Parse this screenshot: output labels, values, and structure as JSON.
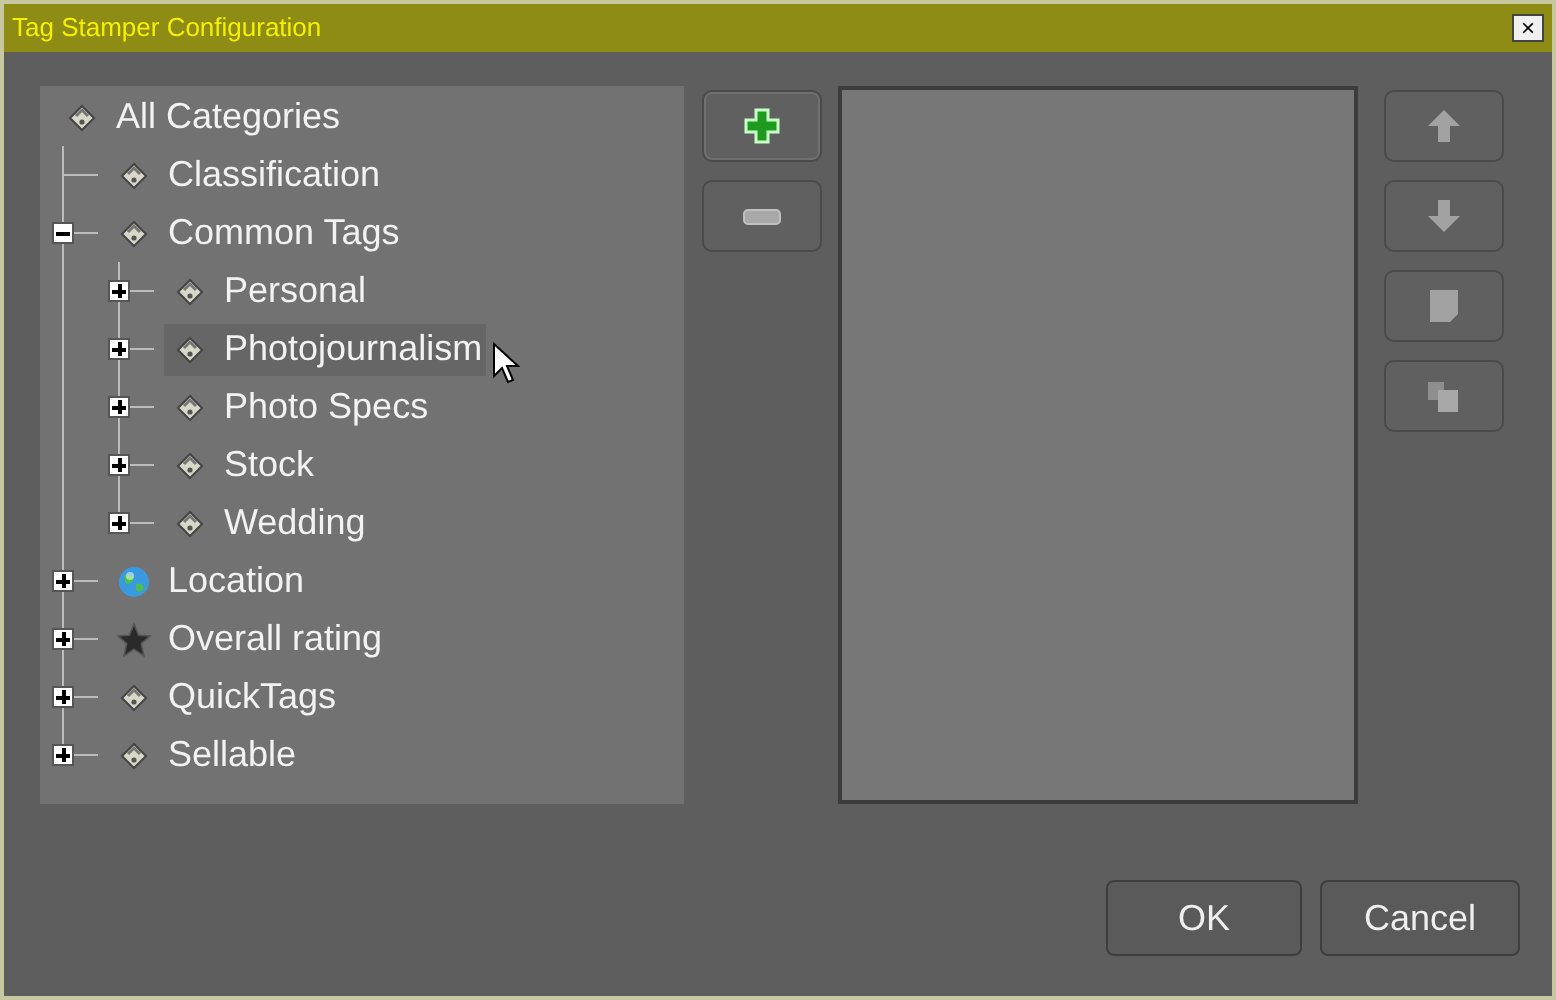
{
  "window": {
    "title": "Tag Stamper Configuration",
    "close": "×"
  },
  "tree": [
    {
      "label": "All Categories",
      "kind": "tag",
      "selected": false,
      "children": [
        {
          "label": "Classification",
          "kind": "tag",
          "selected": false
        },
        {
          "label": "Common Tags",
          "kind": "tag",
          "selected": false,
          "expanded": true,
          "children": [
            {
              "label": "Personal",
              "kind": "tag",
              "selected": false,
              "expanded": false
            },
            {
              "label": "Photojournalism",
              "kind": "tag",
              "selected": true,
              "expanded": false
            },
            {
              "label": "Photo Specs",
              "kind": "tag",
              "selected": false,
              "expanded": false
            },
            {
              "label": "Stock",
              "kind": "tag",
              "selected": false,
              "expanded": false
            },
            {
              "label": "Wedding",
              "kind": "tag",
              "selected": false,
              "expanded": false
            }
          ]
        },
        {
          "label": "Location",
          "kind": "globe",
          "selected": false,
          "expanded": false
        },
        {
          "label": "Overall rating",
          "kind": "star",
          "selected": false,
          "expanded": false
        },
        {
          "label": "QuickTags",
          "kind": "tag",
          "selected": false,
          "expanded": false
        },
        {
          "label": "Sellable",
          "kind": "tag",
          "selected": false,
          "expanded": false
        }
      ]
    }
  ],
  "edit_buttons": [
    {
      "kind": "add",
      "disabled": false
    },
    {
      "kind": "remove",
      "disabled": true
    }
  ],
  "order_buttons": [
    {
      "kind": "up",
      "disabled": true
    },
    {
      "kind": "down",
      "disabled": true
    },
    {
      "kind": "page",
      "disabled": true
    },
    {
      "kind": "copy",
      "disabled": true
    }
  ],
  "buttons": [
    "OK",
    "Cancel"
  ]
}
